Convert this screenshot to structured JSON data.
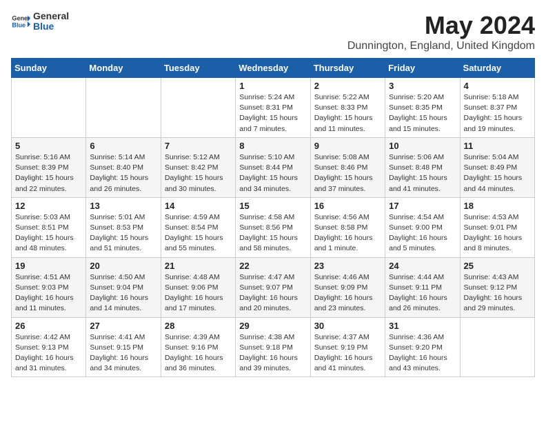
{
  "header": {
    "logo_general": "General",
    "logo_blue": "Blue",
    "month_year": "May 2024",
    "location": "Dunnington, England, United Kingdom"
  },
  "days_of_week": [
    "Sunday",
    "Monday",
    "Tuesday",
    "Wednesday",
    "Thursday",
    "Friday",
    "Saturday"
  ],
  "weeks": [
    [
      {
        "day": "",
        "info": ""
      },
      {
        "day": "",
        "info": ""
      },
      {
        "day": "",
        "info": ""
      },
      {
        "day": "1",
        "info": "Sunrise: 5:24 AM\nSunset: 8:31 PM\nDaylight: 15 hours\nand 7 minutes."
      },
      {
        "day": "2",
        "info": "Sunrise: 5:22 AM\nSunset: 8:33 PM\nDaylight: 15 hours\nand 11 minutes."
      },
      {
        "day": "3",
        "info": "Sunrise: 5:20 AM\nSunset: 8:35 PM\nDaylight: 15 hours\nand 15 minutes."
      },
      {
        "day": "4",
        "info": "Sunrise: 5:18 AM\nSunset: 8:37 PM\nDaylight: 15 hours\nand 19 minutes."
      }
    ],
    [
      {
        "day": "5",
        "info": "Sunrise: 5:16 AM\nSunset: 8:39 PM\nDaylight: 15 hours\nand 22 minutes."
      },
      {
        "day": "6",
        "info": "Sunrise: 5:14 AM\nSunset: 8:40 PM\nDaylight: 15 hours\nand 26 minutes."
      },
      {
        "day": "7",
        "info": "Sunrise: 5:12 AM\nSunset: 8:42 PM\nDaylight: 15 hours\nand 30 minutes."
      },
      {
        "day": "8",
        "info": "Sunrise: 5:10 AM\nSunset: 8:44 PM\nDaylight: 15 hours\nand 34 minutes."
      },
      {
        "day": "9",
        "info": "Sunrise: 5:08 AM\nSunset: 8:46 PM\nDaylight: 15 hours\nand 37 minutes."
      },
      {
        "day": "10",
        "info": "Sunrise: 5:06 AM\nSunset: 8:48 PM\nDaylight: 15 hours\nand 41 minutes."
      },
      {
        "day": "11",
        "info": "Sunrise: 5:04 AM\nSunset: 8:49 PM\nDaylight: 15 hours\nand 44 minutes."
      }
    ],
    [
      {
        "day": "12",
        "info": "Sunrise: 5:03 AM\nSunset: 8:51 PM\nDaylight: 15 hours\nand 48 minutes."
      },
      {
        "day": "13",
        "info": "Sunrise: 5:01 AM\nSunset: 8:53 PM\nDaylight: 15 hours\nand 51 minutes."
      },
      {
        "day": "14",
        "info": "Sunrise: 4:59 AM\nSunset: 8:54 PM\nDaylight: 15 hours\nand 55 minutes."
      },
      {
        "day": "15",
        "info": "Sunrise: 4:58 AM\nSunset: 8:56 PM\nDaylight: 15 hours\nand 58 minutes."
      },
      {
        "day": "16",
        "info": "Sunrise: 4:56 AM\nSunset: 8:58 PM\nDaylight: 16 hours\nand 1 minute."
      },
      {
        "day": "17",
        "info": "Sunrise: 4:54 AM\nSunset: 9:00 PM\nDaylight: 16 hours\nand 5 minutes."
      },
      {
        "day": "18",
        "info": "Sunrise: 4:53 AM\nSunset: 9:01 PM\nDaylight: 16 hours\nand 8 minutes."
      }
    ],
    [
      {
        "day": "19",
        "info": "Sunrise: 4:51 AM\nSunset: 9:03 PM\nDaylight: 16 hours\nand 11 minutes."
      },
      {
        "day": "20",
        "info": "Sunrise: 4:50 AM\nSunset: 9:04 PM\nDaylight: 16 hours\nand 14 minutes."
      },
      {
        "day": "21",
        "info": "Sunrise: 4:48 AM\nSunset: 9:06 PM\nDaylight: 16 hours\nand 17 minutes."
      },
      {
        "day": "22",
        "info": "Sunrise: 4:47 AM\nSunset: 9:07 PM\nDaylight: 16 hours\nand 20 minutes."
      },
      {
        "day": "23",
        "info": "Sunrise: 4:46 AM\nSunset: 9:09 PM\nDaylight: 16 hours\nand 23 minutes."
      },
      {
        "day": "24",
        "info": "Sunrise: 4:44 AM\nSunset: 9:11 PM\nDaylight: 16 hours\nand 26 minutes."
      },
      {
        "day": "25",
        "info": "Sunrise: 4:43 AM\nSunset: 9:12 PM\nDaylight: 16 hours\nand 29 minutes."
      }
    ],
    [
      {
        "day": "26",
        "info": "Sunrise: 4:42 AM\nSunset: 9:13 PM\nDaylight: 16 hours\nand 31 minutes."
      },
      {
        "day": "27",
        "info": "Sunrise: 4:41 AM\nSunset: 9:15 PM\nDaylight: 16 hours\nand 34 minutes."
      },
      {
        "day": "28",
        "info": "Sunrise: 4:39 AM\nSunset: 9:16 PM\nDaylight: 16 hours\nand 36 minutes."
      },
      {
        "day": "29",
        "info": "Sunrise: 4:38 AM\nSunset: 9:18 PM\nDaylight: 16 hours\nand 39 minutes."
      },
      {
        "day": "30",
        "info": "Sunrise: 4:37 AM\nSunset: 9:19 PM\nDaylight: 16 hours\nand 41 minutes."
      },
      {
        "day": "31",
        "info": "Sunrise: 4:36 AM\nSunset: 9:20 PM\nDaylight: 16 hours\nand 43 minutes."
      },
      {
        "day": "",
        "info": ""
      }
    ]
  ]
}
